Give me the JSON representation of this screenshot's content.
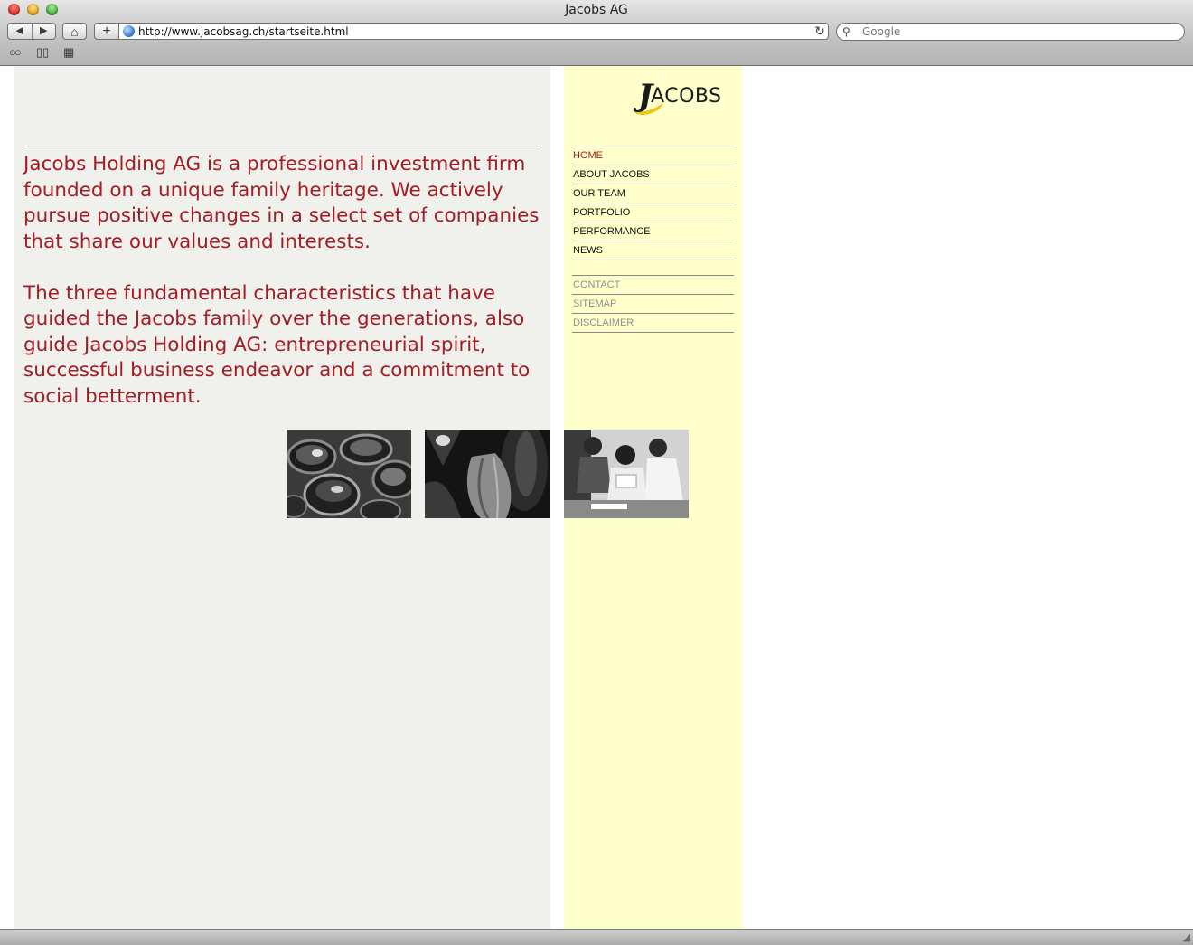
{
  "window": {
    "title": "Jacobs AG"
  },
  "toolbar": {
    "back_icon": "◀",
    "forward_icon": "▶",
    "home_icon": "⌂",
    "add_icon": "+",
    "url": "http://www.jacobsag.ch/startseite.html",
    "reload_icon": "↻",
    "search_placeholder": "Google",
    "search_icon": "⚲"
  },
  "bookmarks_bar": {
    "reading_icon": "○○",
    "bookmarks_icon": "▯▯",
    "topsites_icon": "▦"
  },
  "page": {
    "logo_initial": "J",
    "logo_text": "ACOBS",
    "intro": [
      "Jacobs Holding AG is a professional investment firm founded on a unique family heritage. We actively pursue positive changes in a select set of companies that share our values and interests.",
      "The three fundamental characteristics that have guided the Jacobs family over the generations, also guide Jacobs Holding AG: entrepreneurial spirit, successful business endeavor and a commitment to social betterment."
    ],
    "main_nav": [
      "HOME",
      "ABOUT JACOBS",
      "OUR TEAM",
      "PORTFOLIO",
      "PERFORMANCE",
      "NEWS"
    ],
    "util_nav": [
      "CONTACT",
      "SITEMAP",
      "DISCLAIMER"
    ]
  },
  "colors": {
    "accent_red": "#a51c24",
    "left_column_bg": "#f0f0ec",
    "nav_column_bg": "#ffffcc",
    "logo_swoosh": "#f1c40f"
  }
}
